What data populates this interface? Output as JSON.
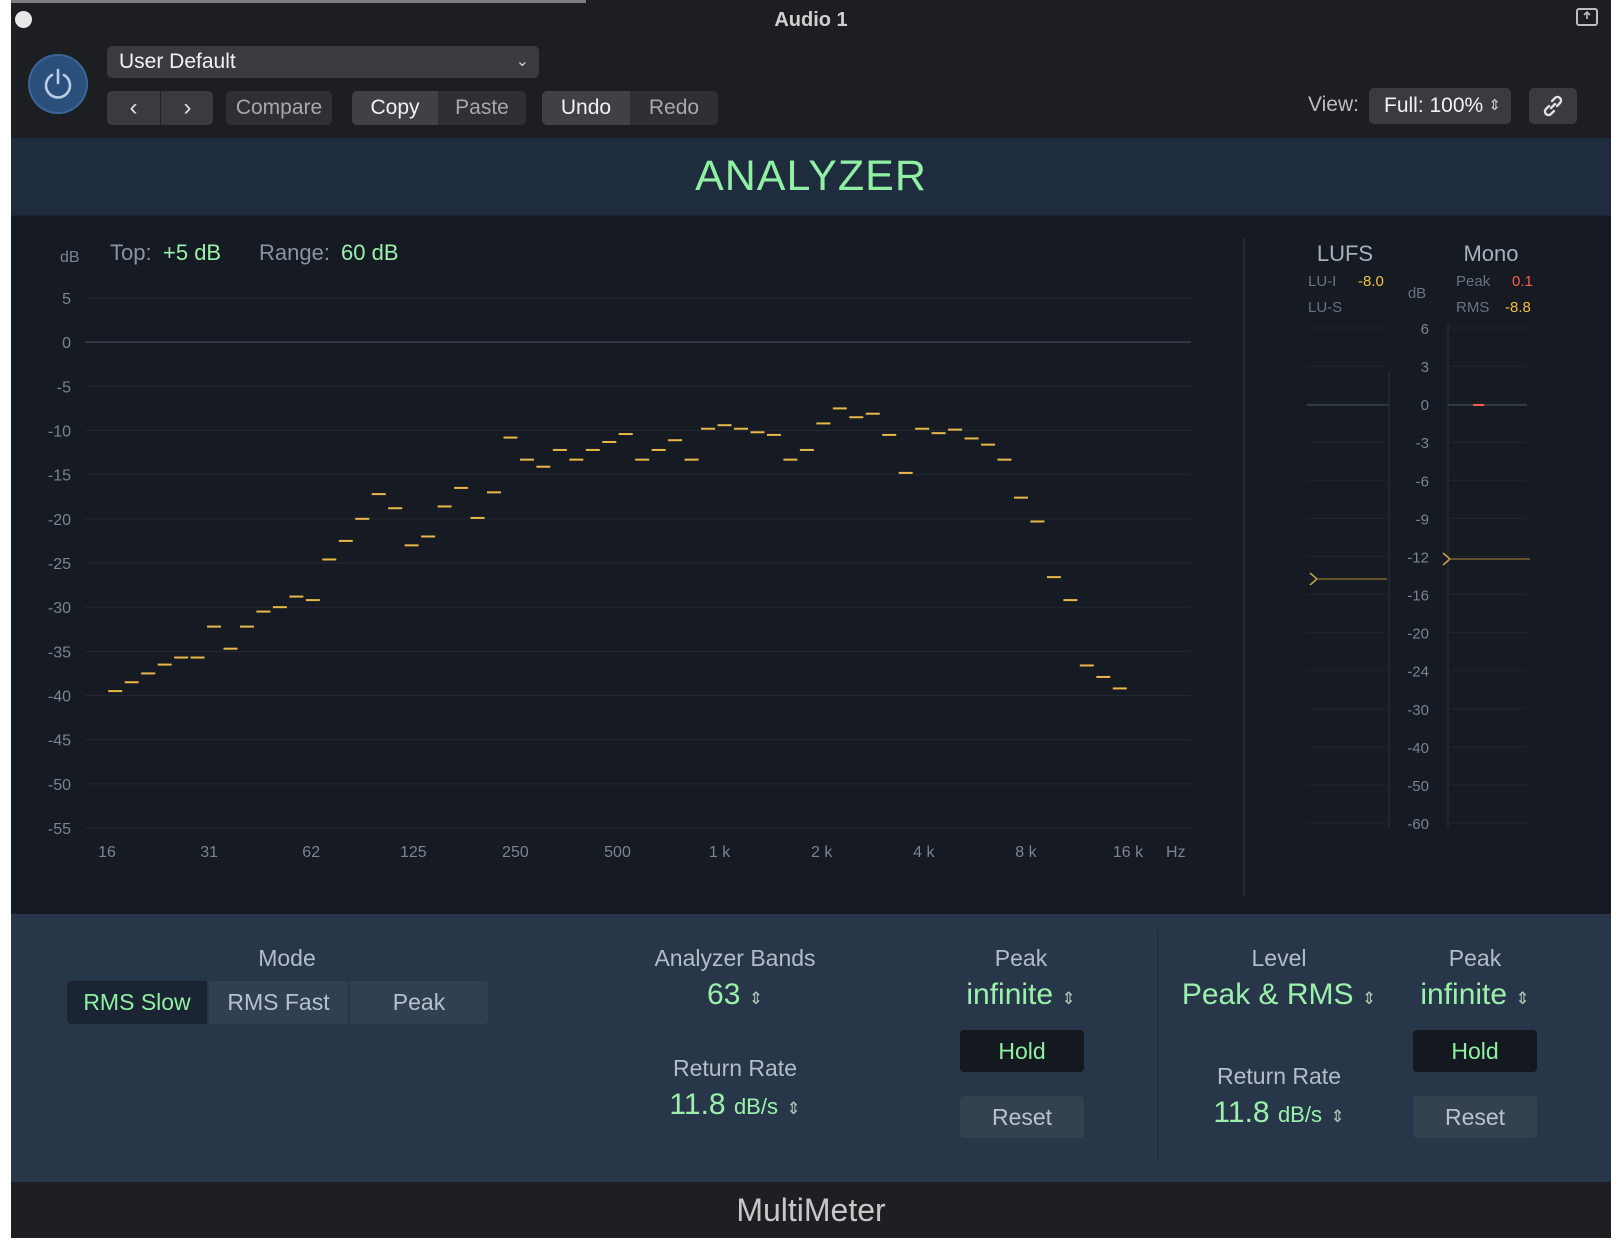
{
  "window": {
    "title": "Audio 1"
  },
  "header": {
    "preset": "User Default",
    "compare_label": "Compare",
    "copy_label": "Copy",
    "paste_label": "Paste",
    "undo_label": "Undo",
    "redo_label": "Redo",
    "view_label": "View:",
    "view_value": "Full: 100%"
  },
  "analyzer": {
    "title": "ANALYZER",
    "db_label": "dB",
    "top_label": "Top:",
    "top_value": "+5 dB",
    "range_label": "Range:",
    "range_value": "60 dB",
    "hz_label": "Hz"
  },
  "chart_data": {
    "type": "bar",
    "title": "",
    "xlabel": "Hz",
    "ylabel": "dB",
    "y_ticks": [
      "5",
      "0",
      "-5",
      "-10",
      "-15",
      "-20",
      "-25",
      "-30",
      "-35",
      "-40",
      "-45",
      "-50",
      "-55"
    ],
    "x_ticks": [
      "16",
      "31",
      "62",
      "125",
      "250",
      "500",
      "1 k",
      "2 k",
      "4 k",
      "8 k",
      "16 k"
    ],
    "ylim": [
      -55,
      5
    ],
    "x_range_octaves": [
      0,
      10
    ],
    "series": [
      {
        "name": "Analyzer Bands",
        "band_count": 63,
        "values": [
          -39.5,
          -38.5,
          -37.5,
          -36.5,
          -35.7,
          -35.7,
          -32.2,
          -34.7,
          -32.2,
          -30.5,
          -30.0,
          -28.8,
          -29.2,
          -24.6,
          -22.5,
          -20.0,
          -17.2,
          -18.8,
          -23.0,
          -22.0,
          -18.6,
          -16.5,
          -19.9,
          -17.0,
          -10.8,
          -13.3,
          -14.1,
          -12.2,
          -13.3,
          -12.2,
          -11.3,
          -10.4,
          -13.3,
          -12.2,
          -11.1,
          -13.3,
          -9.8,
          -9.4,
          -9.8,
          -10.2,
          -10.5,
          -13.3,
          -12.2,
          -9.2,
          -7.5,
          -8.5,
          -8.1,
          -10.5,
          -14.8,
          -9.8,
          -10.3,
          -9.9,
          -10.9,
          -11.6,
          -13.3,
          -17.6,
          -20.3,
          -26.6,
          -29.2,
          -36.6,
          -37.9,
          -39.2
        ]
      }
    ]
  },
  "lufs": {
    "title": "LUFS",
    "lu_i_label": "LU-I",
    "lu_i_value": "-8.0",
    "lu_s_label": "LU-S",
    "db_label": "dB",
    "scale": [
      "6",
      "3",
      "0",
      "-3",
      "-6",
      "-9",
      "-12",
      "-16",
      "-20",
      "-24",
      "-30",
      "-40",
      "-50",
      "-60"
    ]
  },
  "mono": {
    "title": "Mono",
    "peak_label": "Peak",
    "peak_value": "0.1",
    "rms_label": "RMS",
    "rms_value": "-8.8"
  },
  "controls": {
    "mode_label": "Mode",
    "mode_options": [
      "RMS Slow",
      "RMS Fast",
      "Peak"
    ],
    "mode_selected": "RMS Slow",
    "bands_label": "Analyzer Bands",
    "bands_value": "63",
    "return_rate_label": "Return Rate",
    "return_rate_value": "11.8",
    "return_rate_unit": "dB/s",
    "peak_label": "Peak",
    "peak_value": "infinite",
    "hold_label": "Hold",
    "reset_label": "Reset",
    "level_label": "Level",
    "level_value": "Peak & RMS",
    "level_return_rate_label": "Return Rate",
    "level_return_rate_value": "11.8",
    "level_return_rate_unit": "dB/s",
    "level_peak_label": "Peak",
    "level_peak_value": "infinite",
    "level_hold_label": "Hold",
    "level_reset_label": "Reset"
  },
  "footer": {
    "plugin_name": "MultiMeter"
  },
  "colors": {
    "accent_green": "#8ff0a3",
    "bar_yellow": "#e8b84a",
    "peak_red": "#ff5a4a",
    "value_yellow": "#f0c040"
  }
}
